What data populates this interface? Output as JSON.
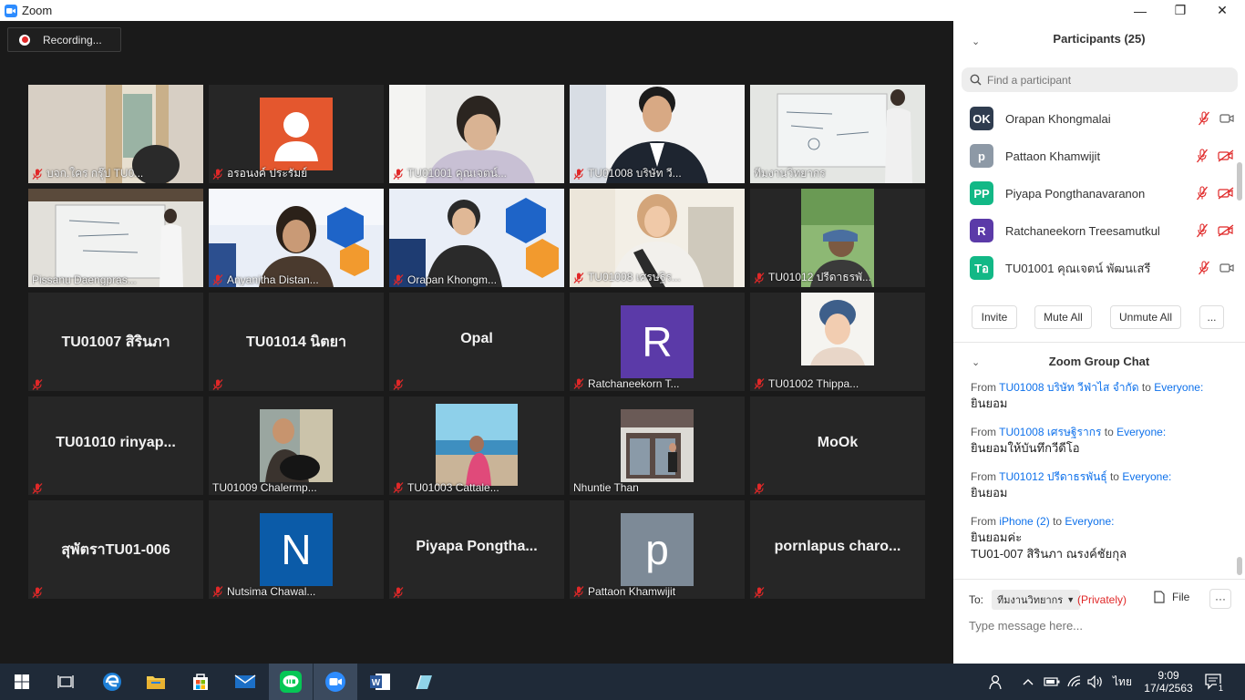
{
  "window": {
    "title": "Zoom",
    "minimize": "—",
    "maximize": "❐",
    "close": "✕"
  },
  "recording": {
    "label": "Recording..."
  },
  "gallery": [
    {
      "name": "บจก.ใคร กรุ๊ป TU0...",
      "type": "video",
      "scene": "window",
      "muted": true
    },
    {
      "name": "อรอนงค์ ประรัมย์",
      "type": "avatar-person",
      "color": "#e4572e",
      "muted": true
    },
    {
      "name": "TU01001 คุณเจตน์...",
      "type": "video",
      "scene": "man-desk",
      "muted": true
    },
    {
      "name": "TU01008 บริษัท วี...",
      "type": "video",
      "scene": "man-suit",
      "muted": true
    },
    {
      "name": "ทีมงานวิทยากร",
      "type": "video",
      "scene": "whiteboard",
      "muted": false
    },
    {
      "name": "Pissanu Daengpras...",
      "type": "video",
      "scene": "whiteboard-speaker",
      "muted": false,
      "active": true
    },
    {
      "name": "Anyanitha Distan...",
      "type": "video",
      "scene": "banner-woman",
      "muted": true
    },
    {
      "name": "Orapan Khongm...",
      "type": "video",
      "scene": "banner-woman2",
      "muted": true
    },
    {
      "name": "TU01008 เศรษฐิร...",
      "type": "video",
      "scene": "woman-room",
      "muted": true
    },
    {
      "name": "TU01012 ปรีดาธรพั...",
      "type": "video",
      "scene": "outdoor",
      "muted": true
    },
    {
      "name": "",
      "label": "TU01007 สิรินภา",
      "type": "text",
      "muted": true
    },
    {
      "name": "",
      "label": "TU01014 นิตยา",
      "type": "text",
      "muted": true
    },
    {
      "name": "",
      "label": "Opal",
      "type": "text",
      "muted": true
    },
    {
      "name": "Ratchaneekorn T...",
      "type": "letter",
      "letter": "R",
      "color": "#5b3aa8",
      "muted": true
    },
    {
      "name": "TU01002 Thippa...",
      "type": "photo",
      "scene": "woman-headscarf",
      "muted": true
    },
    {
      "name": "",
      "label": "TU01010 rinyap...",
      "type": "text",
      "muted": true
    },
    {
      "name": "TU01009 Chalermp...",
      "type": "photo",
      "scene": "man-dog",
      "muted": false
    },
    {
      "name": "TU01003 Cattale...",
      "type": "photo",
      "scene": "beach",
      "muted": true
    },
    {
      "name": "Nhuntie Than",
      "type": "photo",
      "scene": "building",
      "muted": false
    },
    {
      "name": "",
      "label": "MoOk",
      "type": "text",
      "muted": true
    },
    {
      "name": "",
      "label": "สุพัตราTU01-006",
      "type": "text",
      "muted": true
    },
    {
      "name": "Nutsima Chawal...",
      "type": "letter",
      "letter": "N",
      "color": "#0b5ba8",
      "muted": true
    },
    {
      "name": "",
      "label": "Piyapa  Pongtha...",
      "type": "text",
      "muted": true
    },
    {
      "name": "Pattaon Khamwijit",
      "type": "letter",
      "letter": "p",
      "color": "#7d8a97",
      "muted": true
    },
    {
      "name": "",
      "label": "pornlapus  charo...",
      "type": "text",
      "muted": true
    }
  ],
  "participants": {
    "title": "Participants (25)",
    "search_placeholder": "Find a participant",
    "list": [
      {
        "initials": "OK",
        "name": "Orapan Khongmalai",
        "color": "#2f3c4f",
        "video_off": false
      },
      {
        "initials": "p",
        "name": "Pattaon Khamwijit",
        "color": "#8d99a6",
        "video_off": true
      },
      {
        "initials": "PP",
        "name": "Piyapa Pongthanavaranon",
        "color": "#12b886",
        "video_off": true
      },
      {
        "initials": "R",
        "name": "Ratchaneekorn Treesamutkul",
        "color": "#5b3aa8",
        "video_off": true
      },
      {
        "initials": "Tอ",
        "name": "TU01001 คุณเจตน์ พัฒนเสรี",
        "color": "#12b886",
        "video_off": false
      }
    ],
    "buttons": {
      "invite": "Invite",
      "mute_all": "Mute All",
      "unmute_all": "Unmute All",
      "more": "..."
    }
  },
  "chat": {
    "title": "Zoom Group Chat",
    "messages": [
      {
        "from_label": "From",
        "sender": "TU01008 บริษัท วีฟ่าไส จำกัด",
        "to_label": "to",
        "recipient": "Everyone:",
        "lines": [
          "ยินยอม"
        ]
      },
      {
        "from_label": "From",
        "sender": "TU01008 เศรษฐิรากร",
        "to_label": "to",
        "recipient": "Everyone:",
        "lines": [
          "ยินยอมให้บันทึกวีดีโอ"
        ]
      },
      {
        "from_label": "From",
        "sender": "TU01012 ปรีดาธรพันธุ์",
        "to_label": "to",
        "recipient": "Everyone:",
        "lines": [
          "ยินยอม"
        ]
      },
      {
        "from_label": "From",
        "sender": "iPhone (2)",
        "to_label": "to",
        "recipient": "Everyone:",
        "lines": [
          "ยินยอมค่ะ",
          "TU01-007 สิรินภา ณรงค์ชัยกุล"
        ]
      }
    ],
    "to_label": "To:",
    "to_value": "ทีมงานวิทยากร",
    "privately": "(Privately)",
    "file_label": "File",
    "more": "···",
    "input_placeholder": "Type message here..."
  },
  "taskbar": {
    "time": "9:09",
    "date": "17/4/2563",
    "lang": "ไทย",
    "notifications": "1"
  },
  "colors": {
    "accent": "#2d8cff",
    "active_speaker": "#f3e57b",
    "mute_red": "#e02828",
    "link": "#0e71eb"
  }
}
